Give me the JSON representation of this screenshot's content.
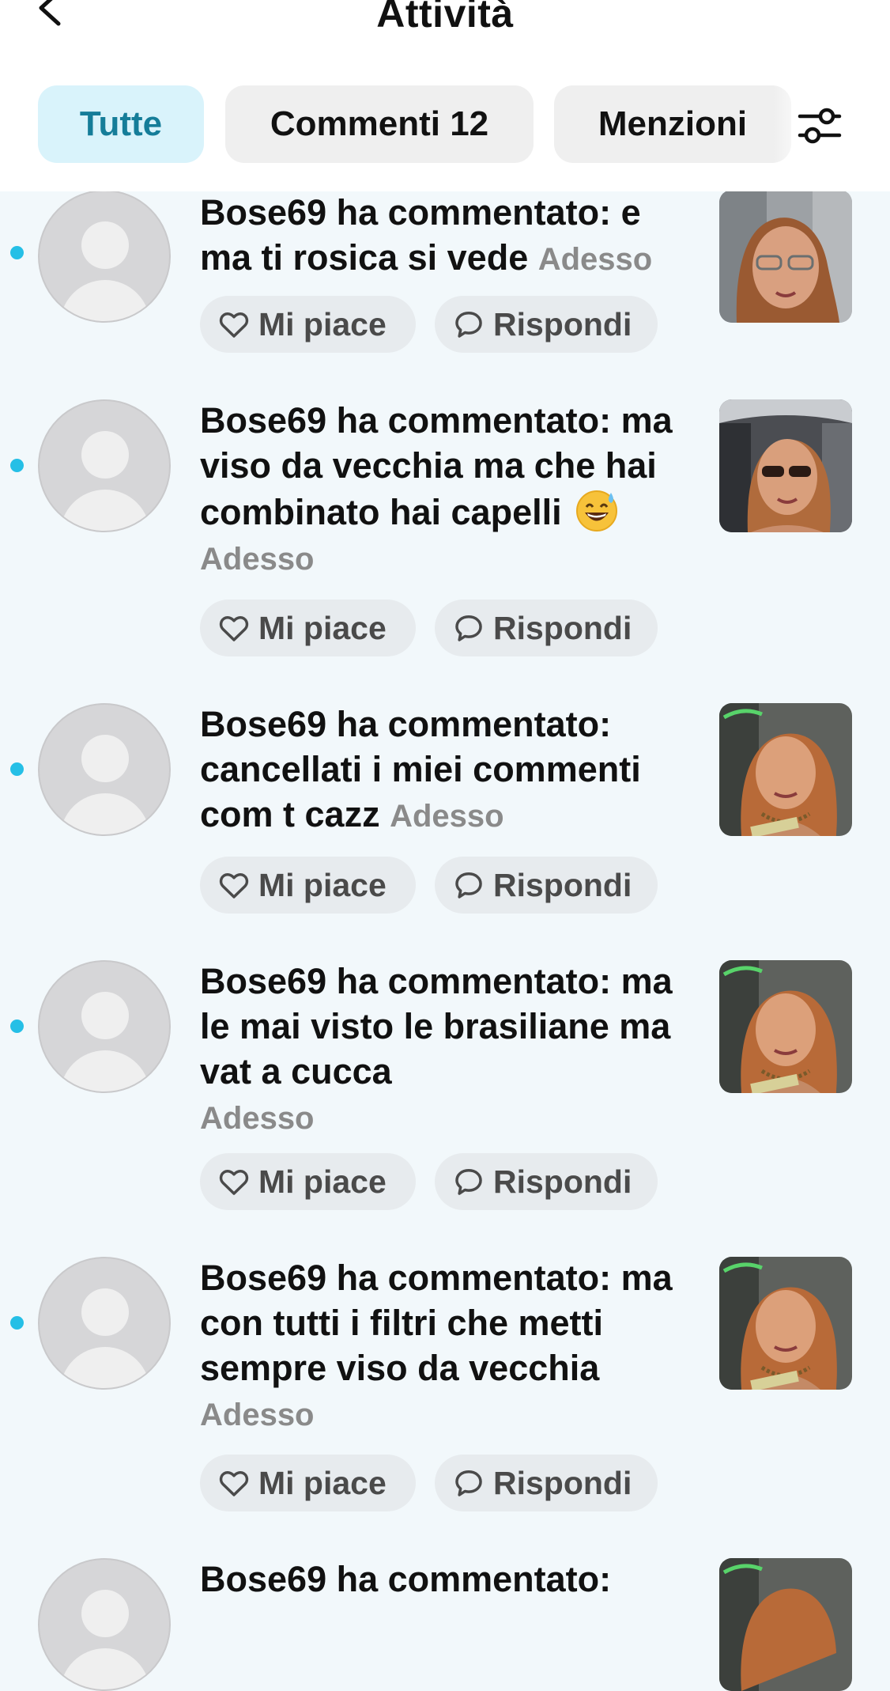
{
  "header": {
    "title": "Attività",
    "back_icon": "chevron-left-icon",
    "filter_icon": "sliders-icon"
  },
  "tabs": [
    {
      "label": "Tutte",
      "active": true
    },
    {
      "label": "Commenti 12",
      "active": false
    },
    {
      "label": "Menzioni",
      "active": false
    }
  ],
  "colors": {
    "accent": "#25bfe6",
    "active_tab_bg": "#d9f3fb",
    "active_tab_text": "#157d99",
    "feed_bg": "#f2f8fb"
  },
  "actions": {
    "like_label": "Mi piace",
    "reply_label": "Rispondi"
  },
  "notifications": [
    {
      "user": "Bose69",
      "prefix": "Bose69 ha commentato: e ma ti rosica si vede",
      "emoji": "",
      "time": "Adesso",
      "unread": true
    },
    {
      "user": "Bose69",
      "prefix": "Bose69 ha commentato: ma viso da vecchia ma che hai combinato hai capelli",
      "emoji": "grinning-sweat-emoji",
      "time": "Adesso",
      "unread": true
    },
    {
      "user": "Bose69",
      "prefix": "Bose69 ha commentato: cancellati i miei commenti com t cazz",
      "emoji": "",
      "time": "Adesso",
      "unread": true
    },
    {
      "user": "Bose69",
      "prefix": "Bose69 ha commentato: ma le mai visto le brasiliane ma vat a cucca",
      "emoji": "",
      "time": "Adesso",
      "unread": true
    },
    {
      "user": "Bose69",
      "prefix": "Bose69 ha commentato: ma con tutti i filtri che metti sempre viso da vecchia",
      "emoji": "",
      "time": "Adesso",
      "unread": true
    },
    {
      "user": "Bose69",
      "prefix": "Bose69 ha commentato:",
      "emoji": "",
      "time": "",
      "unread": false
    }
  ]
}
